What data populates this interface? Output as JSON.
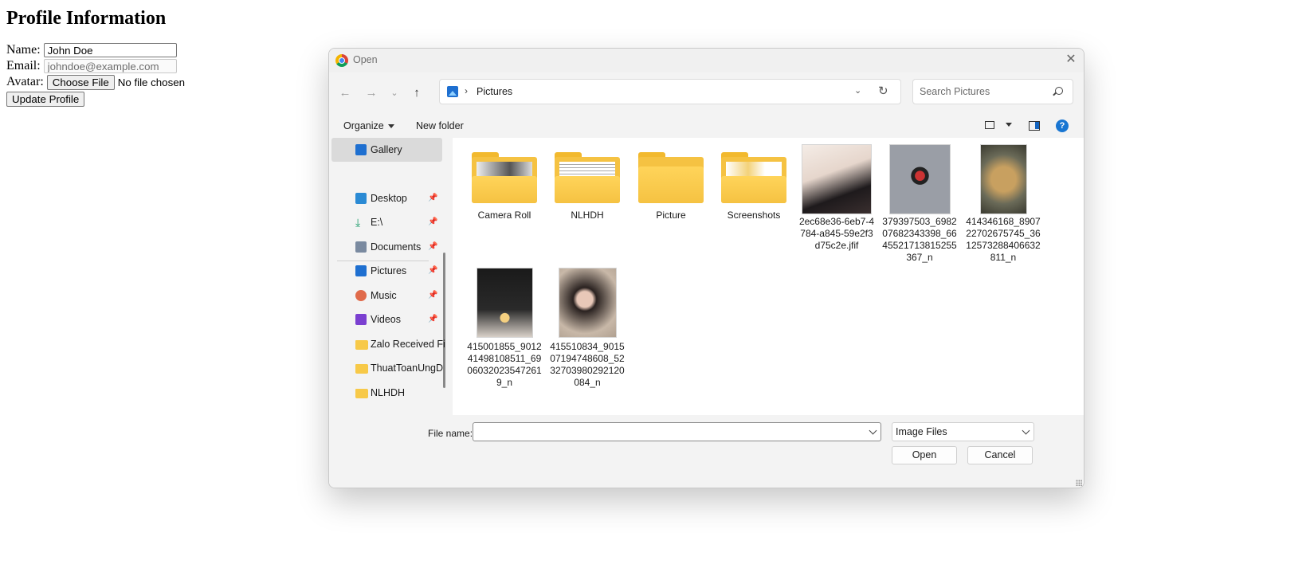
{
  "page": {
    "heading": "Profile Information",
    "name_label": "Name:",
    "name_value": "John Doe",
    "email_label": "Email:",
    "email_value": "johndoe@example.com",
    "avatar_label": "Avatar:",
    "choose_file": "Choose File",
    "no_file": "No file chosen",
    "update_button": "Update Profile"
  },
  "dialog": {
    "title": "Open",
    "address": {
      "location": "Pictures"
    },
    "search_placeholder": "Search Pictures",
    "organize": "Organize",
    "new_folder": "New folder",
    "nav_items": [
      {
        "label": "Gallery",
        "icon": "gallery-icon",
        "color": "#1e6fd0"
      },
      {
        "label": "Desktop",
        "icon": "desktop-icon",
        "color": "#2a8ad4"
      },
      {
        "label": "E:\\",
        "icon": "download-icon",
        "color": "#1a9a6a"
      },
      {
        "label": "Documents",
        "icon": "documents-icon",
        "color": "#7a8aa0"
      },
      {
        "label": "Pictures",
        "icon": "pictures-icon",
        "color": "#1e6fd0"
      },
      {
        "label": "Music",
        "icon": "music-icon",
        "color": "#e06a4a"
      },
      {
        "label": "Videos",
        "icon": "videos-icon",
        "color": "#7a3fd0"
      },
      {
        "label": "Zalo Received Fi",
        "icon": "folder-icon",
        "color": "#f7c948"
      },
      {
        "label": "ThuatToanUngD",
        "icon": "folder-icon",
        "color": "#f7c948"
      },
      {
        "label": "NLHDH",
        "icon": "folder-icon",
        "color": "#f7c948"
      }
    ],
    "items": [
      {
        "label": "Camera Roll",
        "kind": "folder"
      },
      {
        "label": "NLHDH",
        "kind": "folder"
      },
      {
        "label": "Picture",
        "kind": "folder"
      },
      {
        "label": "Screenshots",
        "kind": "folder"
      },
      {
        "label": "2ec68e36-6eb7-4784-a845-59e2f3d75c2e.jfif",
        "kind": "image"
      },
      {
        "label": "379397503_698207682343398_6645521713815255367_n",
        "kind": "image"
      },
      {
        "label": "414346168_890722702675745_3612573288406632811_n",
        "kind": "image"
      },
      {
        "label": "415001855_901241498108511_69060320235472619_n",
        "kind": "image"
      },
      {
        "label": "415510834_901507194748608_5232703980292120084_n",
        "kind": "image"
      }
    ],
    "file_name_label": "File name:",
    "file_name_value": "",
    "filter": "Image Files",
    "open_button": "Open",
    "cancel_button": "Cancel"
  }
}
